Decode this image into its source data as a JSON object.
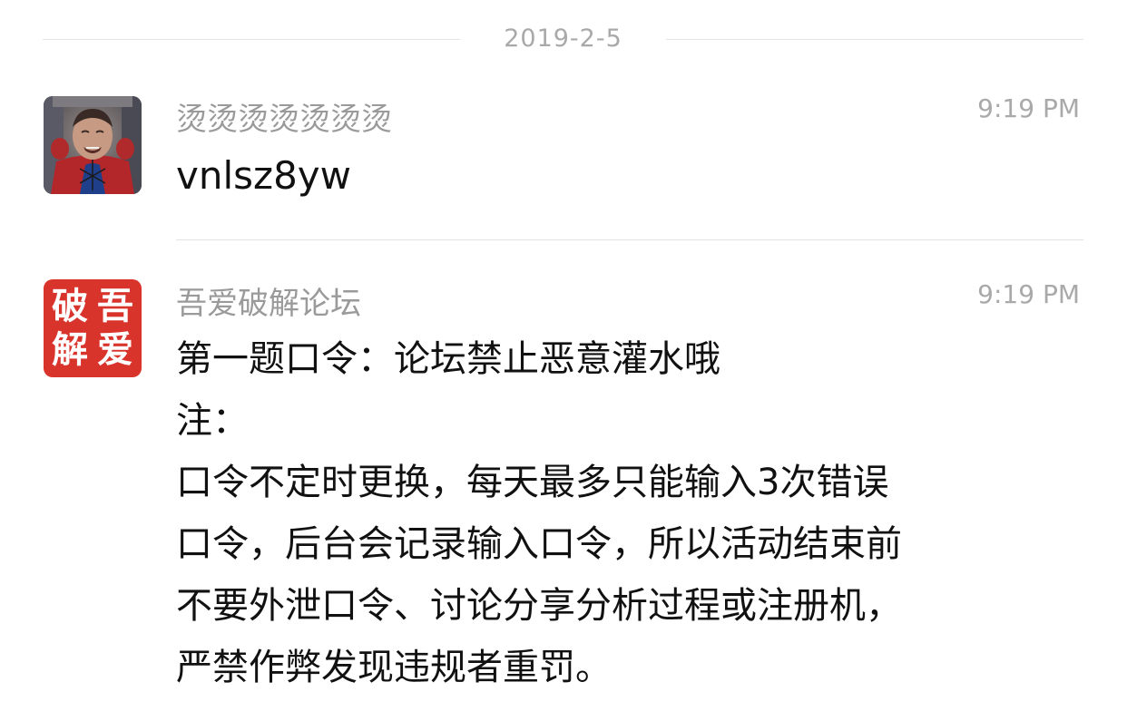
{
  "date_separator": "2019-2-5",
  "messages": [
    {
      "sender": "烫烫烫烫烫烫烫",
      "time": "9:19 PM",
      "text": "vnlsz8yw",
      "avatar_icon": "spiderman-photo-avatar"
    },
    {
      "sender": "吾爱破解论坛",
      "time": "9:19 PM",
      "text": "第一题口令：论坛禁止恶意灌水哦\n注：\n口令不定时更换，每天最多只能输入3次错误\n口令，后台会记录输入口令，所以活动结束前\n不要外泄口令、讨论分享分析过程或注册机，\n严禁作弊发现违规者重罚。",
      "avatar_seal": [
        "破",
        "吾",
        "解",
        "爱"
      ],
      "avatar_color": "#d8342c"
    }
  ],
  "colors": {
    "separator_line": "#e3e3e3",
    "meta_text": "#a9a9a9",
    "body_text": "#111111"
  }
}
